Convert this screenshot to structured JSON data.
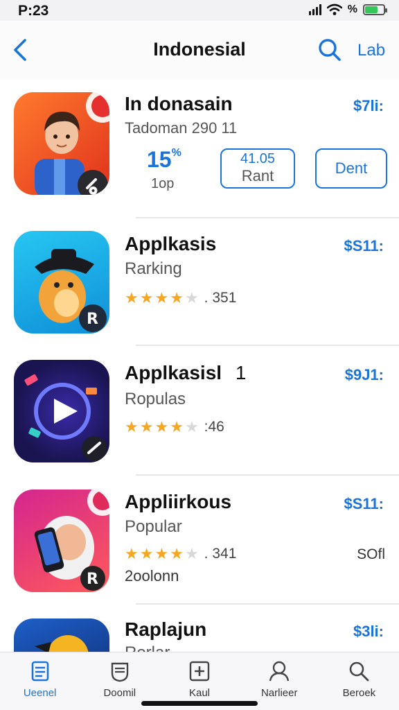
{
  "status_bar": {
    "time": "P:23",
    "battery_pct": "%",
    "battery_level": 0.7
  },
  "nav": {
    "title": "Indonesial",
    "right_label": "Lab"
  },
  "featured": {
    "name": "In donasain",
    "subtitle": "Tadoman 290 11",
    "price": "$7li:",
    "stat_value": "15",
    "stat_unit": "%",
    "stat_label": "1op",
    "rant_button": {
      "line1": "41.05",
      "line2": "Rant"
    },
    "dent_button": "Dent"
  },
  "apps": [
    {
      "name": "Applkasis",
      "category": "Rarking",
      "price": "$S11:",
      "rating": 4,
      "rating_count": "351"
    },
    {
      "name": "Applkasisl",
      "name_suffix": "1",
      "category": "Ropulas",
      "price": "$9J1:",
      "rating": 4,
      "rating_count": "46"
    },
    {
      "name": "Appliirkous",
      "category": "Popular",
      "price": "$S11:",
      "rating": 4,
      "rating_count": "341",
      "side_value": "SOfl",
      "extra": "2oolonn"
    },
    {
      "name": "Raplajun",
      "category": "Rorlar",
      "price": "$3li:"
    }
  ],
  "tabs": [
    {
      "label": "Ueenel",
      "icon": "today-icon",
      "active": true
    },
    {
      "label": "Doomil",
      "icon": "games-icon",
      "active": false
    },
    {
      "label": "Kaul",
      "icon": "apps-icon",
      "active": false
    },
    {
      "label": "Narlieer",
      "icon": "profile-icon",
      "active": false
    },
    {
      "label": "Beroek",
      "icon": "search-icon",
      "active": false
    }
  ],
  "colors": {
    "accent": "#1a73d9",
    "star": "#f5a623"
  }
}
